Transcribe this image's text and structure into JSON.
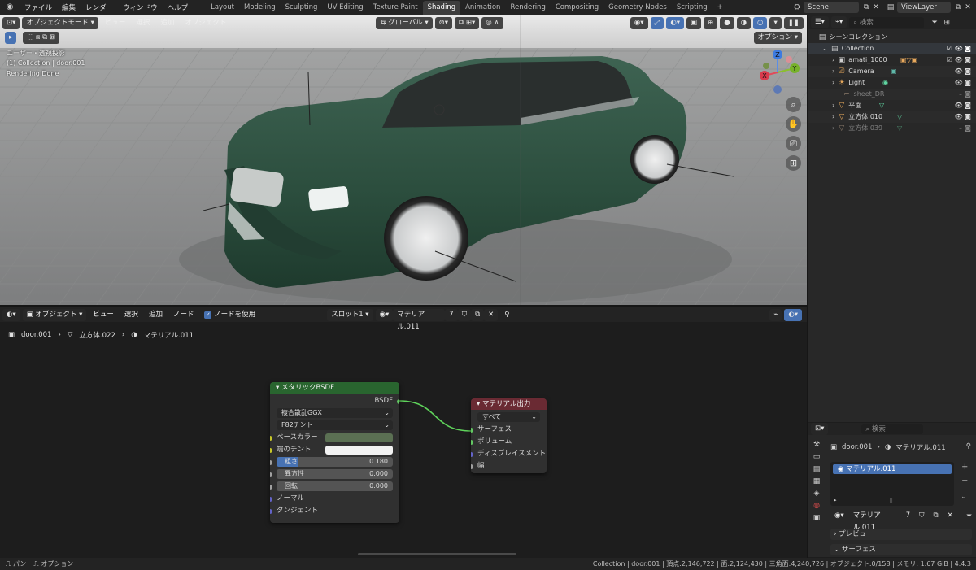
{
  "topbar": {
    "menus": [
      "ファイル",
      "編集",
      "レンダー",
      "ウィンドウ",
      "ヘルプ"
    ],
    "workspaces": [
      "Layout",
      "Modeling",
      "Sculpting",
      "UV Editing",
      "Texture Paint",
      "Shading",
      "Animation",
      "Rendering",
      "Compositing",
      "Geometry Nodes",
      "Scripting"
    ],
    "active_workspace": "Shading",
    "add_tab": "+",
    "scene": "Scene",
    "view_layer": "ViewLayer"
  },
  "viewport": {
    "mode": "オブジェクトモード",
    "menus": [
      "ビュー",
      "選択",
      "追加",
      "オブジェクト"
    ],
    "transform": "グローバル",
    "options": "オプション",
    "overlay_line1": "ユーザー・透視投影",
    "overlay_line2": "(1) Collection | door.001",
    "overlay_line3": "Rendering Done",
    "gizmo": {
      "z": "Z",
      "y": "Y",
      "x": "X"
    }
  },
  "node_editor": {
    "type": "オブジェクト",
    "menus": [
      "ビュー",
      "選択",
      "追加",
      "ノード"
    ],
    "use_nodes": "ノードを使用",
    "slot": "スロット1",
    "material": "マテリアル.011",
    "users": "7",
    "breadcrumb": [
      "door.001",
      "立方体.022",
      "マテリアル.011"
    ],
    "bsdf_node": {
      "title": "メタリックBSDF",
      "output": "BSDF",
      "distribution": "複合散乱GGX",
      "fresnel": "F82チント",
      "base_color_label": "ベースカラー",
      "edge_tint_label": "端のチント",
      "roughness_label": "粗さ",
      "roughness_value": "0.180",
      "anisotropy_label": "異方性",
      "anisotropy_value": "0.000",
      "rotation_label": "回転",
      "rotation_value": "0.000",
      "normal_label": "ノーマル",
      "tangent_label": "タンジェント",
      "base_color": "#5b7053",
      "edge_tint": "#f2f2f2"
    },
    "output_node": {
      "title": "マテリアル出力",
      "target": "すべて",
      "inputs": [
        "サーフェス",
        "ボリューム",
        "ディスプレイスメント",
        "幅"
      ]
    }
  },
  "outliner": {
    "search_placeholder": "検索",
    "root": "シーンコレクション",
    "items": [
      {
        "name": "Collection"
      },
      {
        "name": "amati_1000"
      },
      {
        "name": "Camera"
      },
      {
        "name": "Light"
      },
      {
        "name": "sheet_DR"
      },
      {
        "name": "平面"
      },
      {
        "name": "立方体.010"
      },
      {
        "name": "立方体.039"
      }
    ]
  },
  "properties": {
    "search_placeholder": "検索",
    "object": "door.001",
    "material": "マテリアル.011",
    "slot_item": "マテリアル.011",
    "users": "7",
    "panel_preview": "プレビュー",
    "panel_surface": "サーフェス"
  },
  "statusbar": {
    "left1": "パン",
    "left2": "オプション",
    "right": "Collection | door.001 | 頂点:2,146,722 | 面:2,124,430 | 三角面:4,240,726 | オブジェクト:0/158 | メモリ: 1.67 GiB | 4.4.3"
  },
  "colors": {
    "accent": "#4772b3",
    "node_green": "#29652f",
    "node_red": "#6a2a33",
    "car_green": "#2e5141"
  }
}
